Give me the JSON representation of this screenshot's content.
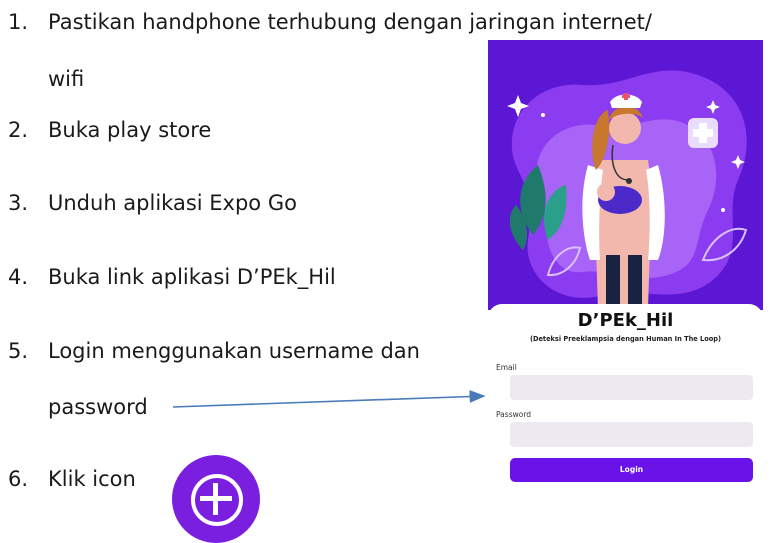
{
  "steps": [
    {
      "num": "1.",
      "text_line1": "Pastikan handphone terhubung dengan jaringan internet/",
      "text_line2": "wifi"
    },
    {
      "num": "2.",
      "text": "Buka play store"
    },
    {
      "num": "3.",
      "text": "Unduh aplikasi Expo Go"
    },
    {
      "num": "4.",
      "text": "Buka link aplikasi D’PEk_Hil"
    },
    {
      "num": "5.",
      "text_line1": "Login menggunakan username dan",
      "text_line2": "password"
    },
    {
      "num": "6.",
      "text": "Klik icon"
    }
  ],
  "phone": {
    "app_title": "D’PEk_Hil",
    "app_subtitle": "(Deteksi Preeklampsia dengan Human In The Loop)",
    "email_label": "Email",
    "password_label": "Password",
    "login_button": "Login"
  },
  "colors": {
    "hero_background": "#5b17d3",
    "login_button": "#6a12e8",
    "add_icon": "#7a1fe0",
    "arrow": "#4a7ab8"
  },
  "icons": {
    "add_icon": "plus-circle-icon"
  }
}
